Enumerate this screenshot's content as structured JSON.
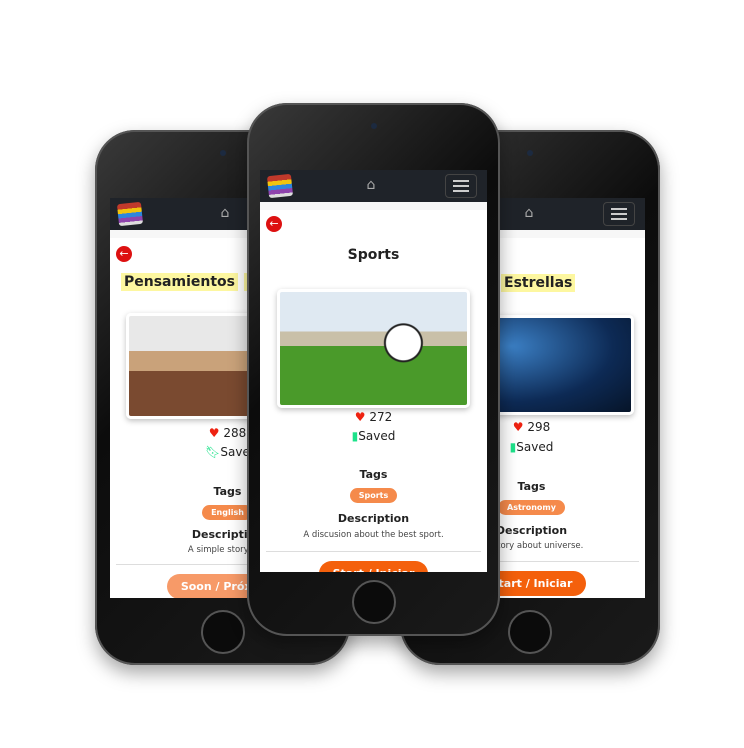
{
  "phones": [
    {
      "title_parts": [
        "Pensamientos",
        "en"
      ],
      "likes": "288",
      "save": "Save",
      "tags_label": "Tags",
      "tag": "English",
      "desc_label": "Description",
      "desc": "A simple story at s",
      "button": "Soon / Próxima"
    },
    {
      "title": "Sports",
      "likes": "272",
      "save": "Saved",
      "tags_label": "Tags",
      "tag": "Sports",
      "desc_label": "Description",
      "desc": "A discusion about the best sport.",
      "button": "Start / Iniciar"
    },
    {
      "title": "Estrellas",
      "likes": "298",
      "save": "Saved",
      "tags_label": "Tags",
      "tag": "Astronomy",
      "desc_label": "Description",
      "desc": "tic story about universe.",
      "button": "Start / Iniciar"
    }
  ],
  "colors": {
    "accent": "#f58a4b",
    "button_active": "#f4600c",
    "button_soon": "#f79a68",
    "heart": "#e21",
    "saved": "#1de28a"
  }
}
